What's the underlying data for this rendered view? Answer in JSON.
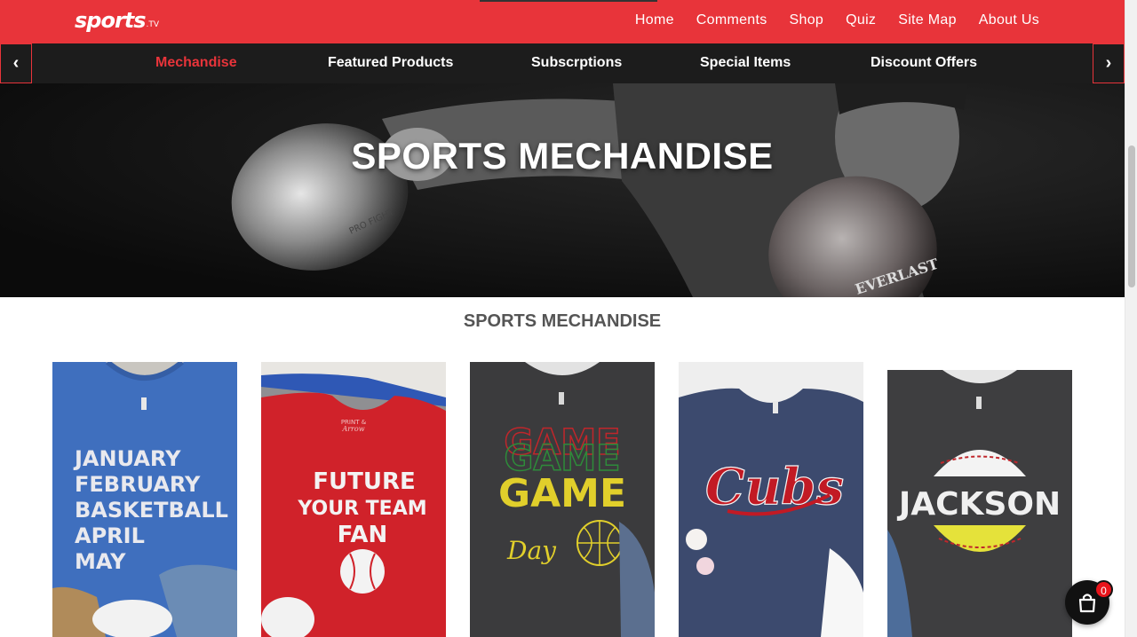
{
  "brand": {
    "logo": "sports",
    "logo_suffix": ".TV",
    "accent_color": "#e8343a"
  },
  "topnav": {
    "items": [
      "Home",
      "Comments",
      "Shop",
      "Quiz",
      "Site Map",
      "About Us"
    ]
  },
  "categories": {
    "prev_icon": "chevron-left-icon",
    "next_icon": "chevron-right-icon",
    "prev_label": "‹",
    "next_label": "›",
    "items": [
      "Mechandise",
      "Featured Products",
      "Subscrptions",
      "Special Items",
      "Discount Offers"
    ],
    "active": "Mechandise"
  },
  "hero": {
    "title": "SPORTS MECHANDISE",
    "glove_text_left": "PRO FIGHT",
    "glove_text_right": "EVERLAST"
  },
  "section": {
    "title": "SPORTS MECHANDISE"
  },
  "products": [
    {
      "shirt_color": "#3f6fbe",
      "print_lines": [
        "JANUARY",
        "FEBRUARY",
        "BASKETBALL",
        "APRIL",
        "MAY"
      ]
    },
    {
      "shirt_color": "#d0222a",
      "print_lines": [
        "FUTURE",
        "YOUR TEAM",
        "FAN"
      ],
      "collar_tag": [
        "PRINT &",
        "Arrow"
      ]
    },
    {
      "shirt_color": "#3b3b3d",
      "print_lines": [
        "GAME",
        "GAME",
        "GAME",
        "Day"
      ]
    },
    {
      "shirt_color": "#3c4a6e",
      "print_lines": [
        "Cubs"
      ]
    },
    {
      "shirt_color": "#3e3e40",
      "print_lines": [
        "JACKSON"
      ]
    }
  ],
  "cart": {
    "icon": "shopping-bag-icon",
    "count": "0"
  }
}
